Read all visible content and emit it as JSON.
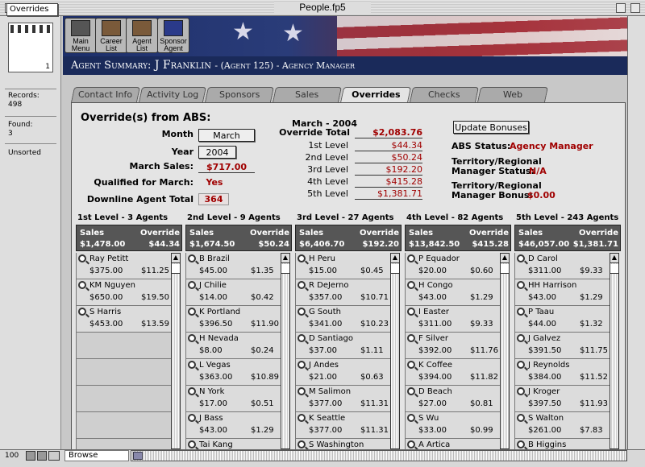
{
  "window": {
    "title": "People.fp5"
  },
  "status_area": {
    "layout_name": "Overrides",
    "book_page": "1",
    "records_label": "Records:",
    "records_value": "498",
    "found_label": "Found:",
    "found_value": "3",
    "sort_state": "Unsorted"
  },
  "nav_buttons": [
    {
      "label1": "Main",
      "label2": "Menu",
      "icon": "main-menu-icon"
    },
    {
      "label1": "Career",
      "label2": "List",
      "icon": "career-list-icon"
    },
    {
      "label1": "Agent",
      "label2": "List",
      "icon": "agent-list-icon"
    },
    {
      "label1": "Sponsor",
      "label2": "Agent",
      "icon": "sponsor-agent-icon"
    }
  ],
  "header": {
    "prefix": "Agent Summary:",
    "agent_name": "J Franklin",
    "agent_detail": "- (Agent 125) - Agency Manager"
  },
  "tabs": [
    {
      "label": "Contact Info",
      "active": false
    },
    {
      "label": "Activity Log",
      "active": false
    },
    {
      "label": "Sponsors",
      "active": false
    },
    {
      "label": "Sales",
      "active": false
    },
    {
      "label": "Overrides",
      "active": true
    },
    {
      "label": "Checks",
      "active": false
    },
    {
      "label": "Web",
      "active": false
    }
  ],
  "override": {
    "title": "Override(s) from ABS:",
    "month_label": "Month",
    "month_value": "March",
    "year_label": "Year",
    "year_value": "2004",
    "march_sales_label": "March Sales:",
    "march_sales_value": "$717.00",
    "qualified_label": "Qualified for March:",
    "qualified_value": "Yes",
    "downline_label": "Downline Agent Total",
    "downline_value": "364"
  },
  "totals": {
    "period": "March - 2004",
    "total_label": "Override Total",
    "total_value": "$2,083.76",
    "levels": [
      {
        "label": "1st Level",
        "value": "$44.34"
      },
      {
        "label": "2nd Level",
        "value": "$50.24"
      },
      {
        "label": "3rd Level",
        "value": "$192.20"
      },
      {
        "label": "4th Level",
        "value": "$415.28"
      },
      {
        "label": "5th Level",
        "value": "$1,381.71"
      }
    ]
  },
  "bonus": {
    "update_button": "Update Bonuses",
    "abs_status_label": "ABS Status:",
    "abs_status_value": "Agency Manager",
    "territory_status_label1": "Territory/Regional",
    "territory_status_label2": "Manager Status:",
    "territory_status_value": "N/A",
    "territory_bonus_label1": "Territory/Regional",
    "territory_bonus_label2": "Manager Bonus:",
    "territory_bonus_value": "$0.00"
  },
  "columns": [
    {
      "title": "1st Level - 3 Agents",
      "sales_label": "Sales",
      "override_label": "Override",
      "sales_total": "$1,478.00",
      "override_total": "$44.34",
      "rows": [
        {
          "name": "Ray Petitt",
          "sales": "$375.00",
          "override": "$11.25"
        },
        {
          "name": "KM Nguyen",
          "sales": "$650.00",
          "override": "$19.50"
        },
        {
          "name": "S Harris",
          "sales": "$453.00",
          "override": "$13.59"
        }
      ]
    },
    {
      "title": "2nd Level - 9 Agents",
      "sales_label": "Sales",
      "override_label": "Override",
      "sales_total": "$1,674.50",
      "override_total": "$50.24",
      "rows": [
        {
          "name": "B Brazil",
          "sales": "$45.00",
          "override": "$1.35"
        },
        {
          "name": "J Chilie",
          "sales": "$14.00",
          "override": "$0.42"
        },
        {
          "name": "K Portland",
          "sales": "$396.50",
          "override": "$11.90"
        },
        {
          "name": "H Nevada",
          "sales": "$8.00",
          "override": "$0.24"
        },
        {
          "name": "L Vegas",
          "sales": "$363.00",
          "override": "$10.89"
        },
        {
          "name": "N York",
          "sales": "$17.00",
          "override": "$0.51"
        },
        {
          "name": "J Bass",
          "sales": "$43.00",
          "override": "$1.29"
        },
        {
          "name": "Tai Kang",
          "sales": "",
          "override": ""
        }
      ]
    },
    {
      "title": "3rd Level - 27 Agents",
      "sales_label": "Sales",
      "override_label": "Override",
      "sales_total": "$6,406.70",
      "override_total": "$192.20",
      "rows": [
        {
          "name": "H Peru",
          "sales": "$15.00",
          "override": "$0.45"
        },
        {
          "name": "R DeJerno",
          "sales": "$357.00",
          "override": "$10.71"
        },
        {
          "name": "G South",
          "sales": "$341.00",
          "override": "$10.23"
        },
        {
          "name": "D Santiago",
          "sales": "$37.00",
          "override": "$1.11"
        },
        {
          "name": "J Andes",
          "sales": "$21.00",
          "override": "$0.63"
        },
        {
          "name": "M Salimon",
          "sales": "$377.00",
          "override": "$11.31"
        },
        {
          "name": "K Seattle",
          "sales": "$377.00",
          "override": "$11.31"
        },
        {
          "name": "S Washington",
          "sales": "",
          "override": ""
        }
      ]
    },
    {
      "title": "4th Level - 82 Agents",
      "sales_label": "Sales",
      "override_label": "Override",
      "sales_total": "$13,842.50",
      "override_total": "$415.28",
      "rows": [
        {
          "name": "P Equador",
          "sales": "$20.00",
          "override": "$0.60"
        },
        {
          "name": "H Congo",
          "sales": "$43.00",
          "override": "$1.29"
        },
        {
          "name": "I Easter",
          "sales": "$311.00",
          "override": "$9.33"
        },
        {
          "name": "F Silver",
          "sales": "$392.00",
          "override": "$11.76"
        },
        {
          "name": "K Coffee",
          "sales": "$394.00",
          "override": "$11.82"
        },
        {
          "name": "D Beach",
          "sales": "$27.00",
          "override": "$0.81"
        },
        {
          "name": "S Wu",
          "sales": "$33.00",
          "override": "$0.99"
        },
        {
          "name": "A Artica",
          "sales": "",
          "override": ""
        }
      ]
    },
    {
      "title": "5th Level - 243 Agents",
      "sales_label": "Sales",
      "override_label": "Override",
      "sales_total": "$46,057.00",
      "override_total": "$1,381.71",
      "rows": [
        {
          "name": "D Carol",
          "sales": "$311.00",
          "override": "$9.33"
        },
        {
          "name": "HH Harrison",
          "sales": "$43.00",
          "override": "$1.29"
        },
        {
          "name": "P Taau",
          "sales": "$44.00",
          "override": "$1.32"
        },
        {
          "name": "J Galvez",
          "sales": "$391.50",
          "override": "$11.75"
        },
        {
          "name": "J Reynolds",
          "sales": "$384.00",
          "override": "$11.52"
        },
        {
          "name": "J Kroger",
          "sales": "$397.50",
          "override": "$11.93"
        },
        {
          "name": "S Walton",
          "sales": "$261.00",
          "override": "$7.83"
        },
        {
          "name": "B Higgins",
          "sales": "",
          "override": ""
        }
      ]
    }
  ],
  "bottom": {
    "zoom": "100",
    "mode": "Browse"
  }
}
